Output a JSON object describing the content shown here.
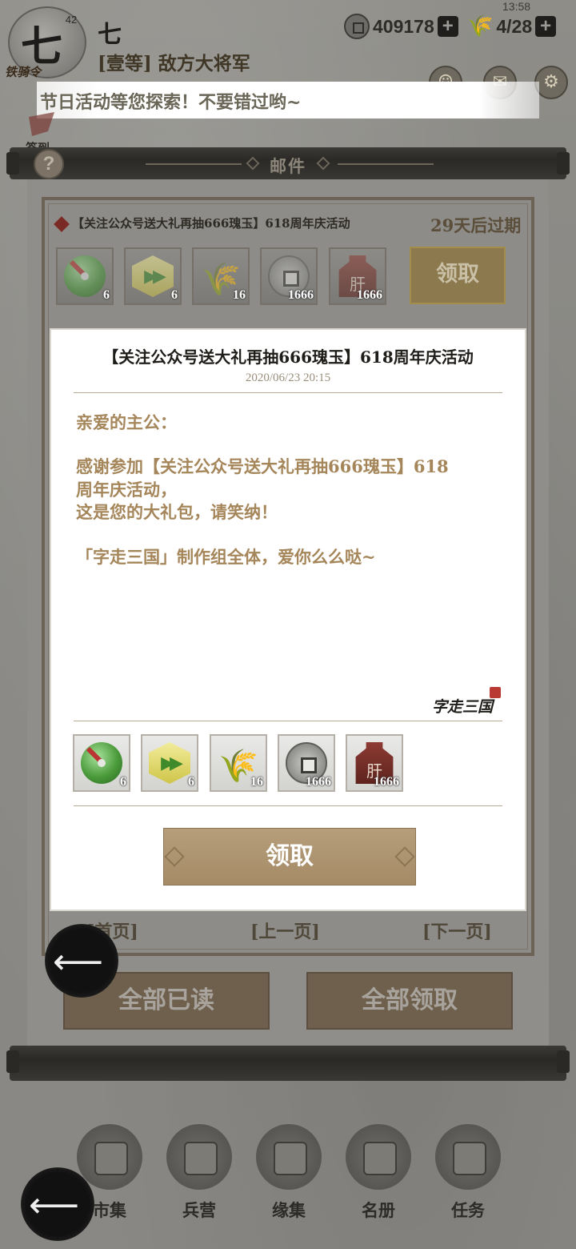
{
  "hud": {
    "avatar_char": "七",
    "level": "42",
    "seal_text": "铁骑令",
    "player_name": "七",
    "player_rank": "[壹等] 敌方大将军",
    "coins": "409178",
    "grain": "4/28",
    "plus": "+",
    "clock": "13:58",
    "marquee": "节日活动等您探索！不要错过哟~",
    "side_label": "签到"
  },
  "panel": {
    "title": "邮件",
    "help": "?"
  },
  "mail_row": {
    "title": "【关注公众号送大礼再抽666瑰玉】618周年庆活动",
    "expire": "29天后过期",
    "claim": "领取",
    "items": [
      {
        "icon": "jade-disc-icon",
        "count": "6"
      },
      {
        "icon": "speedup-icon",
        "count": "6"
      },
      {
        "icon": "wheat-icon",
        "count": "16"
      },
      {
        "icon": "copper-coin-icon",
        "count": "1666"
      },
      {
        "icon": "liver-bell-icon",
        "count": "1666"
      }
    ]
  },
  "dialog": {
    "title": "【关注公众号送大礼再抽666瑰玉】618周年庆活动",
    "date": "2020/06/23 20:15",
    "lines": [
      "亲爱的主公：",
      "感谢参加【关注公众号送大礼再抽666瑰玉】618",
      "周年庆活动，",
      "这是您的大礼包，请笑纳！",
      "「字走三国」制作组全体，爱你么么哒~"
    ],
    "signature": "字走三国",
    "items": [
      {
        "icon": "jade-disc-icon",
        "count": "6"
      },
      {
        "icon": "speedup-icon",
        "count": "6"
      },
      {
        "icon": "wheat-icon",
        "count": "16"
      },
      {
        "icon": "copper-coin-icon",
        "count": "1666"
      },
      {
        "icon": "liver-bell-icon",
        "count": "1666"
      }
    ],
    "claim": "领取"
  },
  "pager": {
    "first": "[首页]",
    "prev": "[上一页]",
    "next": "[下一页]"
  },
  "actions": {
    "read_all": "全部已读",
    "claim_all": "全部领取"
  },
  "nav": [
    {
      "label": "市集",
      "icon": "market-icon"
    },
    {
      "label": "兵营",
      "icon": "barracks-icon"
    },
    {
      "label": "缘集",
      "icon": "fate-icon"
    },
    {
      "label": "名册",
      "icon": "roster-icon"
    },
    {
      "label": "任务",
      "icon": "quest-icon"
    }
  ],
  "colors": {
    "accent_gold": "#a5865a",
    "claim_button": "#b69e7b",
    "danger_diamond": "#7b2b26"
  }
}
